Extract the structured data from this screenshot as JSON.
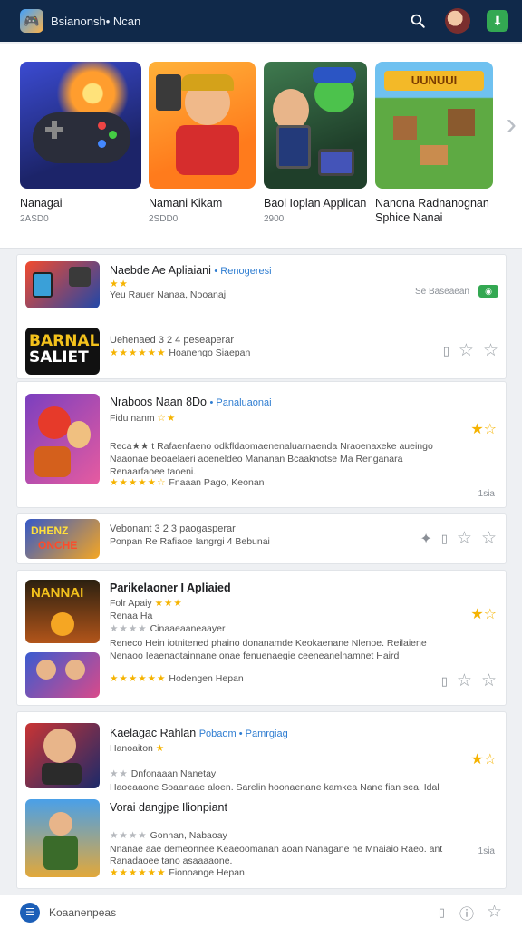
{
  "header": {
    "title": "Bsianonsh• Ncan",
    "icons": [
      "search-icon",
      "user-avatar",
      "download-icon"
    ]
  },
  "featured": {
    "items": [
      {
        "name": "Nanagai",
        "meta": "2ASD0"
      },
      {
        "name": "Namani Kikam",
        "meta": "2SDD0"
      },
      {
        "name": "Baol Ioplan Applican",
        "meta": "2900"
      },
      {
        "name": "Nanona Radnanognan",
        "name2": "Sphice Nanai",
        "meta": ""
      }
    ]
  },
  "list1": {
    "rows": [
      {
        "title": "Naebde Ae Apliaiani",
        "category": "• Renogeresi",
        "sub": "Yeu Rauer Nanaa, Nooanaj",
        "right_text": "Se Baseaean"
      },
      {
        "title": "Uehenaed 3 2 4 peseaperar",
        "sub": "Hoanengo Siaepan"
      }
    ]
  },
  "list2": {
    "title": "Nraboos Naan 8Do",
    "category": "• Panaluaonai",
    "sub": "Fidu nanm",
    "desc": [
      "Reca★★ t Rafaenfaeno odkfldaomaenenaluarnaenda Nraoenaxeke aueingo",
      "Naaonae beoaelaeri aoeneldeo Mananan Bcaaknotse Ma Renganara",
      "Renaarfaoee taoeni.",
      "Fnaaan Pago, Keonan"
    ],
    "corner": "1sia"
  },
  "list3": {
    "title": "Vebonant 3 2 3 paogasperar",
    "sub": "Ponpan Re Rafiaoe Iangrgi 4 Bebunai"
  },
  "list4": {
    "rows": [
      {
        "title": "Parikelaoner I Apliaied",
        "sub": "Folr Apaiy",
        "sub2": "Renaa Ha",
        "grey": "Cinaaeaaneaayer",
        "desc": [
          "Reneco Hein iotnitened phaino donanamde Keokaenane Nlenoe. Reilaiene",
          "Nenaoo Ieaenaotainnane onae fenuenaegie ceeneanelnamnet Haird",
          "Hodengen Hepan"
        ]
      }
    ]
  },
  "list5": {
    "rows": [
      {
        "title": "Kaelagac Rahlan",
        "category": "Pobaom • Pamrgiag",
        "sub": "Hanoaiton",
        "grey": "Dnfonaaan Nanetay",
        "desc": [
          "Haoeaaone Soaanaae aloen. Sarelin hoonaenane kamkea Nane fian sea, Idal",
          "Vorai dangjpe Ilionpiant"
        ]
      },
      {
        "title": "Vorai dangjpe Ilionpiant",
        "grey": "Gonnan, Nabaoay",
        "desc": [
          "Nnanae aae demeonnee Keaeoomanan aoan Nanagane he Mnaiaio Raeo. ant",
          "Ranadaoee tano asaaaaone.",
          "Fionoange Hepan"
        ],
        "corner": "1sia"
      }
    ]
  },
  "bottom": {
    "label": "Koaanenpeas"
  },
  "colors": {
    "header_bg": "#10294a",
    "accent_blue": "#2f7dd1",
    "star_yellow": "#f5b301",
    "green": "#33a852"
  }
}
